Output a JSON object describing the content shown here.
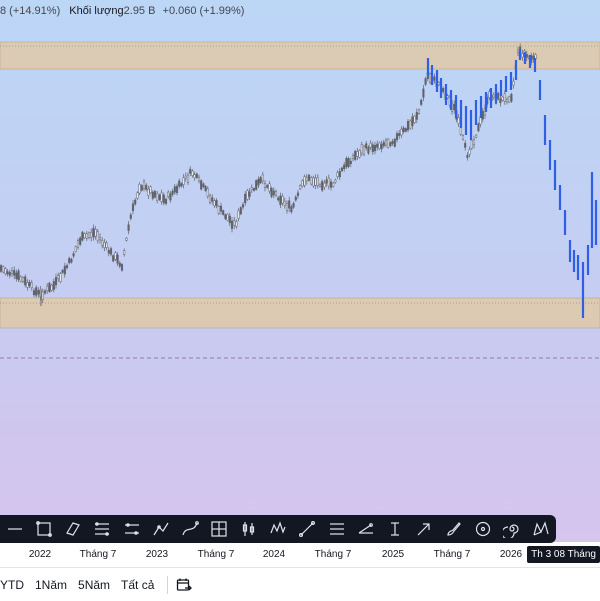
{
  "legend": {
    "ohlc_tail": "8 (+14.91%)",
    "volume_label": "Khối lượng",
    "volume_value": "2.95 B",
    "volume_change": "+0.060 (+1.99%)"
  },
  "colors": {
    "zone_fill": "#e0c9a8",
    "candle": "#5f6269",
    "projection": "#2f5fe6",
    "dashed_line": "#8a5ab0",
    "toolbar_bg": "#131722"
  },
  "toolbar": {
    "tools": [
      {
        "id": "line",
        "icon": "line-tool-icon"
      },
      {
        "id": "rectangle",
        "icon": "rectangle-icon"
      },
      {
        "id": "parallel-channel",
        "icon": "parallel-channel-icon"
      },
      {
        "id": "fib-retracement",
        "icon": "fib-retracement-icon"
      },
      {
        "id": "fib-extension",
        "icon": "fib-extension-icon"
      },
      {
        "id": "polyline",
        "icon": "polyline-icon"
      },
      {
        "id": "path",
        "icon": "path-icon"
      },
      {
        "id": "gann-box",
        "icon": "gann-box-icon"
      },
      {
        "id": "long-position",
        "icon": "long-position-icon"
      },
      {
        "id": "elliott-wave",
        "icon": "elliott-wave-icon"
      },
      {
        "id": "trend-line",
        "icon": "trend-line-icon"
      },
      {
        "id": "horizontal-lines",
        "icon": "horizontal-lines-icon"
      },
      {
        "id": "trend-angle",
        "icon": "trend-angle-icon"
      },
      {
        "id": "text",
        "icon": "text-cursor-icon"
      },
      {
        "id": "arrow",
        "icon": "arrow-icon"
      },
      {
        "id": "brush",
        "icon": "brush-icon"
      },
      {
        "id": "circle",
        "icon": "circle-icon"
      },
      {
        "id": "spiral",
        "icon": "spiral-icon"
      },
      {
        "id": "xabcd",
        "icon": "xabcd-pattern-icon"
      }
    ]
  },
  "time_axis": {
    "ticks": [
      "2022",
      "Tháng 7",
      "2023",
      "Tháng 7",
      "2024",
      "Tháng 7",
      "2025",
      "Tháng 7",
      "2026"
    ],
    "crosshair_label": "Th 3 08 Tháng"
  },
  "ranges": [
    "YTD",
    "1Năm",
    "5Năm",
    "Tất cả"
  ],
  "date_range_icon": "calendar-range-icon"
}
